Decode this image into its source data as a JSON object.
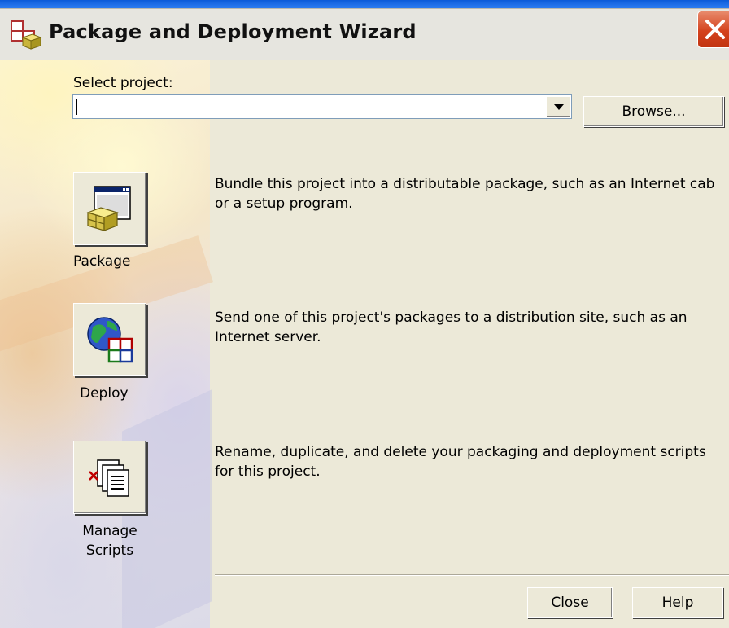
{
  "window": {
    "title": "Package and Deployment Wizard"
  },
  "project": {
    "label": "Select project:",
    "value": "",
    "browse_label": "Browse..."
  },
  "actions": [
    {
      "label": "Package",
      "description": "Bundle this project into a distributable package, such as an Internet cab or a setup program."
    },
    {
      "label": "Deploy",
      "description": "Send one of this project's packages to a distribution site, such as an Internet server."
    },
    {
      "label_line1": "Manage",
      "label_line2": "Scripts",
      "description": "Rename, duplicate, and delete your packaging and deployment scripts for this project."
    }
  ],
  "footer": {
    "close_label": "Close",
    "help_label": "Help"
  },
  "colors": {
    "face": "#ece9d8",
    "title_band": "#e6e5df",
    "close_button": "#d4421d"
  }
}
